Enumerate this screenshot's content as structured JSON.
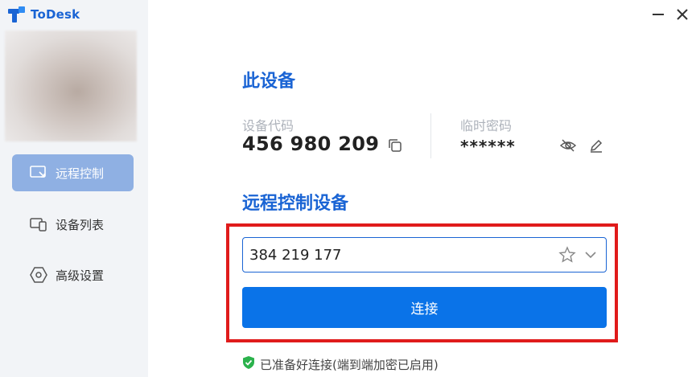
{
  "app": {
    "name": "ToDesk"
  },
  "sidebar": {
    "items": [
      {
        "label": "远程控制",
        "icon": "remote-control-icon",
        "active": true
      },
      {
        "label": "设备列表",
        "icon": "device-list-icon",
        "active": false
      },
      {
        "label": "高级设置",
        "icon": "settings-icon",
        "active": false
      }
    ]
  },
  "this_device": {
    "title": "此设备",
    "code_label": "设备代码",
    "code": "456 980 209",
    "password_label": "临时密码",
    "password": "******"
  },
  "remote": {
    "title": "远程控制设备",
    "input_value": "384 219 177",
    "connect_label": "连接"
  },
  "status": {
    "text": "已准备好连接(端到端加密已启用)"
  },
  "colors": {
    "accent": "#1a64d4",
    "button": "#0a73e8",
    "highlight": "#e01b1b",
    "ok": "#2bb24c"
  }
}
